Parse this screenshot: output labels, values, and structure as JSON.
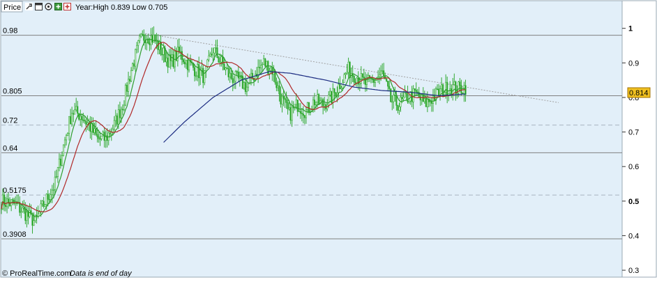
{
  "header": {
    "title": "Price",
    "info": "Year:High 0.839 Low 0.705",
    "icons": [
      "wrench-icon",
      "window-icon",
      "gear-icon",
      "expand-icon",
      "close-icon"
    ]
  },
  "footer": {
    "brand": "© ProRealTime.com",
    "note": "Data is end of day"
  },
  "price_tag": "0.814",
  "colors": {
    "background": "#e2eff9",
    "candle": "#33aa33",
    "ma_fast": "#2e9e2e",
    "ma_medium": "#b02828",
    "ma_slow": "#1a2a80",
    "trendline": "#a0a0a0",
    "level_lines": "#808080",
    "price_tag_bg": "#f0c020"
  },
  "chart_data": {
    "type": "line",
    "title": "Price",
    "ylim": [
      0.28,
      1.08
    ],
    "yticks": [
      {
        "value": 1.0,
        "label": "1",
        "bold": true
      },
      {
        "value": 0.9,
        "label": "0.9",
        "bold": false
      },
      {
        "value": 0.8,
        "label": "0.8",
        "bold": false
      },
      {
        "value": 0.7,
        "label": "0.7",
        "bold": false
      },
      {
        "value": 0.6,
        "label": "0.6",
        "bold": false
      },
      {
        "value": 0.5,
        "label": "0.5",
        "bold": true
      },
      {
        "value": 0.4,
        "label": "0.4",
        "bold": false
      },
      {
        "value": 0.3,
        "label": "0.3",
        "bold": false
      }
    ],
    "levels": [
      {
        "value": 0.98,
        "label": "0.98",
        "style": "solid"
      },
      {
        "value": 0.805,
        "label": "0.805",
        "style": "solid"
      },
      {
        "value": 0.72,
        "label": "0.72",
        "style": "dashed"
      },
      {
        "value": 0.64,
        "label": "0.64",
        "style": "solid"
      },
      {
        "value": 0.5175,
        "label": "0.5175",
        "style": "dashed"
      },
      {
        "value": 0.3908,
        "label": "0.3908",
        "style": "solid"
      }
    ],
    "xlim": [
      0,
      330
    ],
    "x_extent": 440,
    "trendline": [
      [
        102,
        0.985
      ],
      [
        395,
        0.785
      ]
    ],
    "price_anchors": [
      [
        0,
        0.5
      ],
      [
        10,
        0.49
      ],
      [
        18,
        0.46
      ],
      [
        24,
        0.44
      ],
      [
        30,
        0.49
      ],
      [
        38,
        0.55
      ],
      [
        44,
        0.66
      ],
      [
        50,
        0.76
      ],
      [
        56,
        0.75
      ],
      [
        62,
        0.72
      ],
      [
        68,
        0.68
      ],
      [
        74,
        0.68
      ],
      [
        80,
        0.72
      ],
      [
        86,
        0.78
      ],
      [
        92,
        0.88
      ],
      [
        98,
        0.96
      ],
      [
        102,
        0.98
      ],
      [
        108,
        0.97
      ],
      [
        114,
        0.93
      ],
      [
        120,
        0.9
      ],
      [
        126,
        0.93
      ],
      [
        132,
        0.9
      ],
      [
        138,
        0.88
      ],
      [
        144,
        0.86
      ],
      [
        150,
        0.94
      ],
      [
        156,
        0.9
      ],
      [
        162,
        0.86
      ],
      [
        168,
        0.85
      ],
      [
        174,
        0.83
      ],
      [
        180,
        0.87
      ],
      [
        186,
        0.9
      ],
      [
        192,
        0.88
      ],
      [
        198,
        0.8
      ],
      [
        204,
        0.75
      ],
      [
        210,
        0.78
      ],
      [
        216,
        0.76
      ],
      [
        222,
        0.79
      ],
      [
        228,
        0.78
      ],
      [
        234,
        0.8
      ],
      [
        240,
        0.84
      ],
      [
        246,
        0.88
      ],
      [
        252,
        0.86
      ],
      [
        258,
        0.84
      ],
      [
        264,
        0.85
      ],
      [
        270,
        0.87
      ],
      [
        276,
        0.79
      ],
      [
        282,
        0.78
      ],
      [
        288,
        0.8
      ],
      [
        294,
        0.81
      ],
      [
        300,
        0.78
      ],
      [
        306,
        0.8
      ],
      [
        312,
        0.82
      ],
      [
        318,
        0.83
      ],
      [
        324,
        0.825
      ],
      [
        329,
        0.83
      ]
    ],
    "series": [
      {
        "role": "ma_fast",
        "period": 8
      },
      {
        "role": "ma_medium",
        "period": 20
      },
      {
        "role": "ma_slow",
        "start": 115,
        "anchors": [
          [
            115,
            0.67
          ],
          [
            130,
            0.73
          ],
          [
            150,
            0.8
          ],
          [
            170,
            0.85
          ],
          [
            190,
            0.875
          ],
          [
            205,
            0.87
          ],
          [
            230,
            0.85
          ],
          [
            250,
            0.83
          ],
          [
            270,
            0.82
          ],
          [
            290,
            0.815
          ],
          [
            310,
            0.805
          ],
          [
            329,
            0.81
          ]
        ]
      }
    ]
  }
}
